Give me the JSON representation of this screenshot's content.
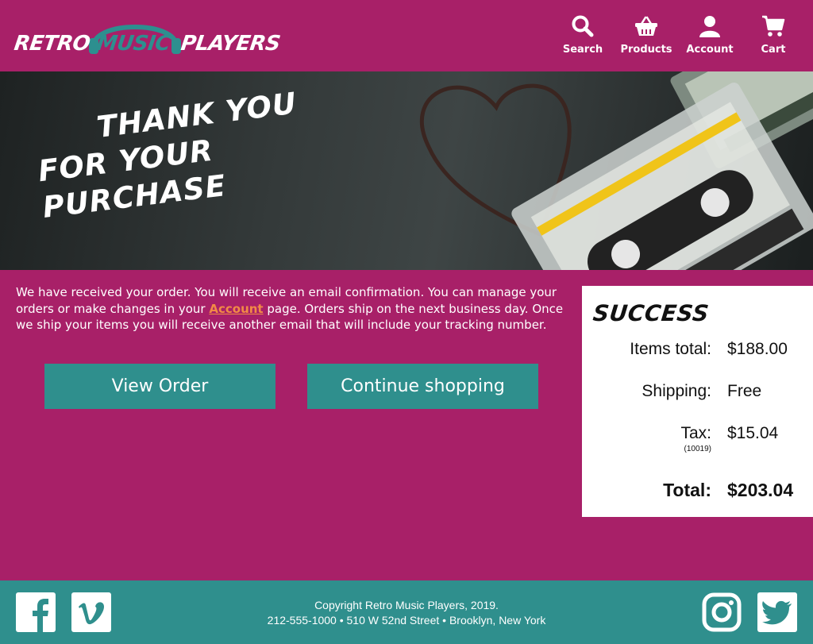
{
  "brand": {
    "word1": "RETRO",
    "word2": "MUSIC",
    "word3": "PLAYERS",
    "primary_color": "#a82068",
    "accent_color": "#2f8f8d",
    "link_color": "#f28a45"
  },
  "nav": {
    "items": [
      {
        "label": "Search",
        "icon": "search-icon"
      },
      {
        "label": "Products",
        "icon": "basket-icon"
      },
      {
        "label": "Account",
        "icon": "user-icon"
      },
      {
        "label": "Cart",
        "icon": "cart-icon"
      }
    ]
  },
  "hero": {
    "line1": "THANK YOU",
    "line2": "FOR YOUR PURCHASE"
  },
  "message": {
    "before_link": "We have received your order.  You will receive an email confirmation.  You can manage your orders or make changes in your ",
    "link": "Account",
    "after_link": " page.  Orders ship on the next business day.  Once we ship your items you will receive another email that will include your tracking number."
  },
  "buttons": {
    "view_order": "View Order",
    "continue_shopping": "Continue shopping"
  },
  "summary": {
    "title": "SUCCESS",
    "items_total_label": "Items total:",
    "items_total_value": "$188.00",
    "shipping_label": "Shipping:",
    "shipping_value": "Free",
    "tax_label": "Tax:",
    "tax_zip": "(10019)",
    "tax_value": "$15.04",
    "total_label": "Total:",
    "total_value": "$203.04"
  },
  "footer": {
    "copyright": "Copyright Retro Music Players, 2019.",
    "contact": "212-555-1000 • 510 W 52nd Street • Brooklyn, New York",
    "social": [
      "facebook-icon",
      "vimeo-icon",
      "instagram-icon",
      "twitter-icon"
    ]
  }
}
